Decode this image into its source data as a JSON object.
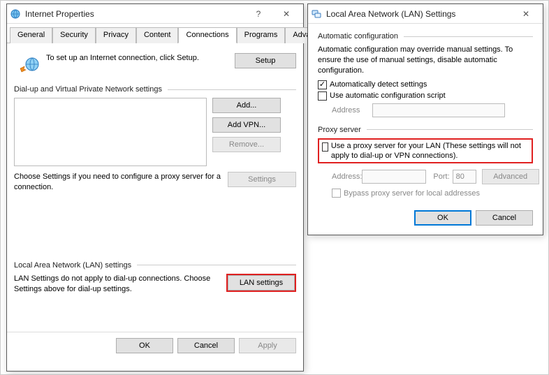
{
  "inet": {
    "title": "Internet Properties",
    "tabs": [
      "General",
      "Security",
      "Privacy",
      "Content",
      "Connections",
      "Programs",
      "Advanced"
    ],
    "active_tab": "Connections",
    "setup_text": "To set up an Internet connection, click Setup.",
    "setup_btn": "Setup",
    "dialup_header": "Dial-up and Virtual Private Network settings",
    "add_btn": "Add...",
    "add_vpn_btn": "Add VPN...",
    "remove_btn": "Remove...",
    "settings_btn": "Settings",
    "dialup_note": "Choose Settings if you need to configure a proxy server for a connection.",
    "lan_header": "Local Area Network (LAN) settings",
    "lan_note": "LAN Settings do not apply to dial-up connections. Choose Settings above for dial-up settings.",
    "lan_btn": "LAN settings",
    "ok": "OK",
    "cancel": "Cancel",
    "apply": "Apply"
  },
  "lan": {
    "title": "Local Area Network (LAN) Settings",
    "auto_header": "Automatic configuration",
    "auto_desc": "Automatic configuration may override manual settings.  To ensure the use of manual settings, disable automatic configuration.",
    "auto_detect": "Automatically detect settings",
    "use_script": "Use automatic configuration script",
    "address_label": "Address",
    "proxy_header": "Proxy server",
    "proxy_use": "Use a proxy server for your LAN (These settings will not apply to dial-up or VPN connections).",
    "proxy_addr_label": "Address:",
    "proxy_port_label": "Port:",
    "proxy_port_value": "80",
    "advanced_btn": "Advanced",
    "bypass": "Bypass proxy server for local addresses",
    "ok": "OK",
    "cancel": "Cancel"
  }
}
